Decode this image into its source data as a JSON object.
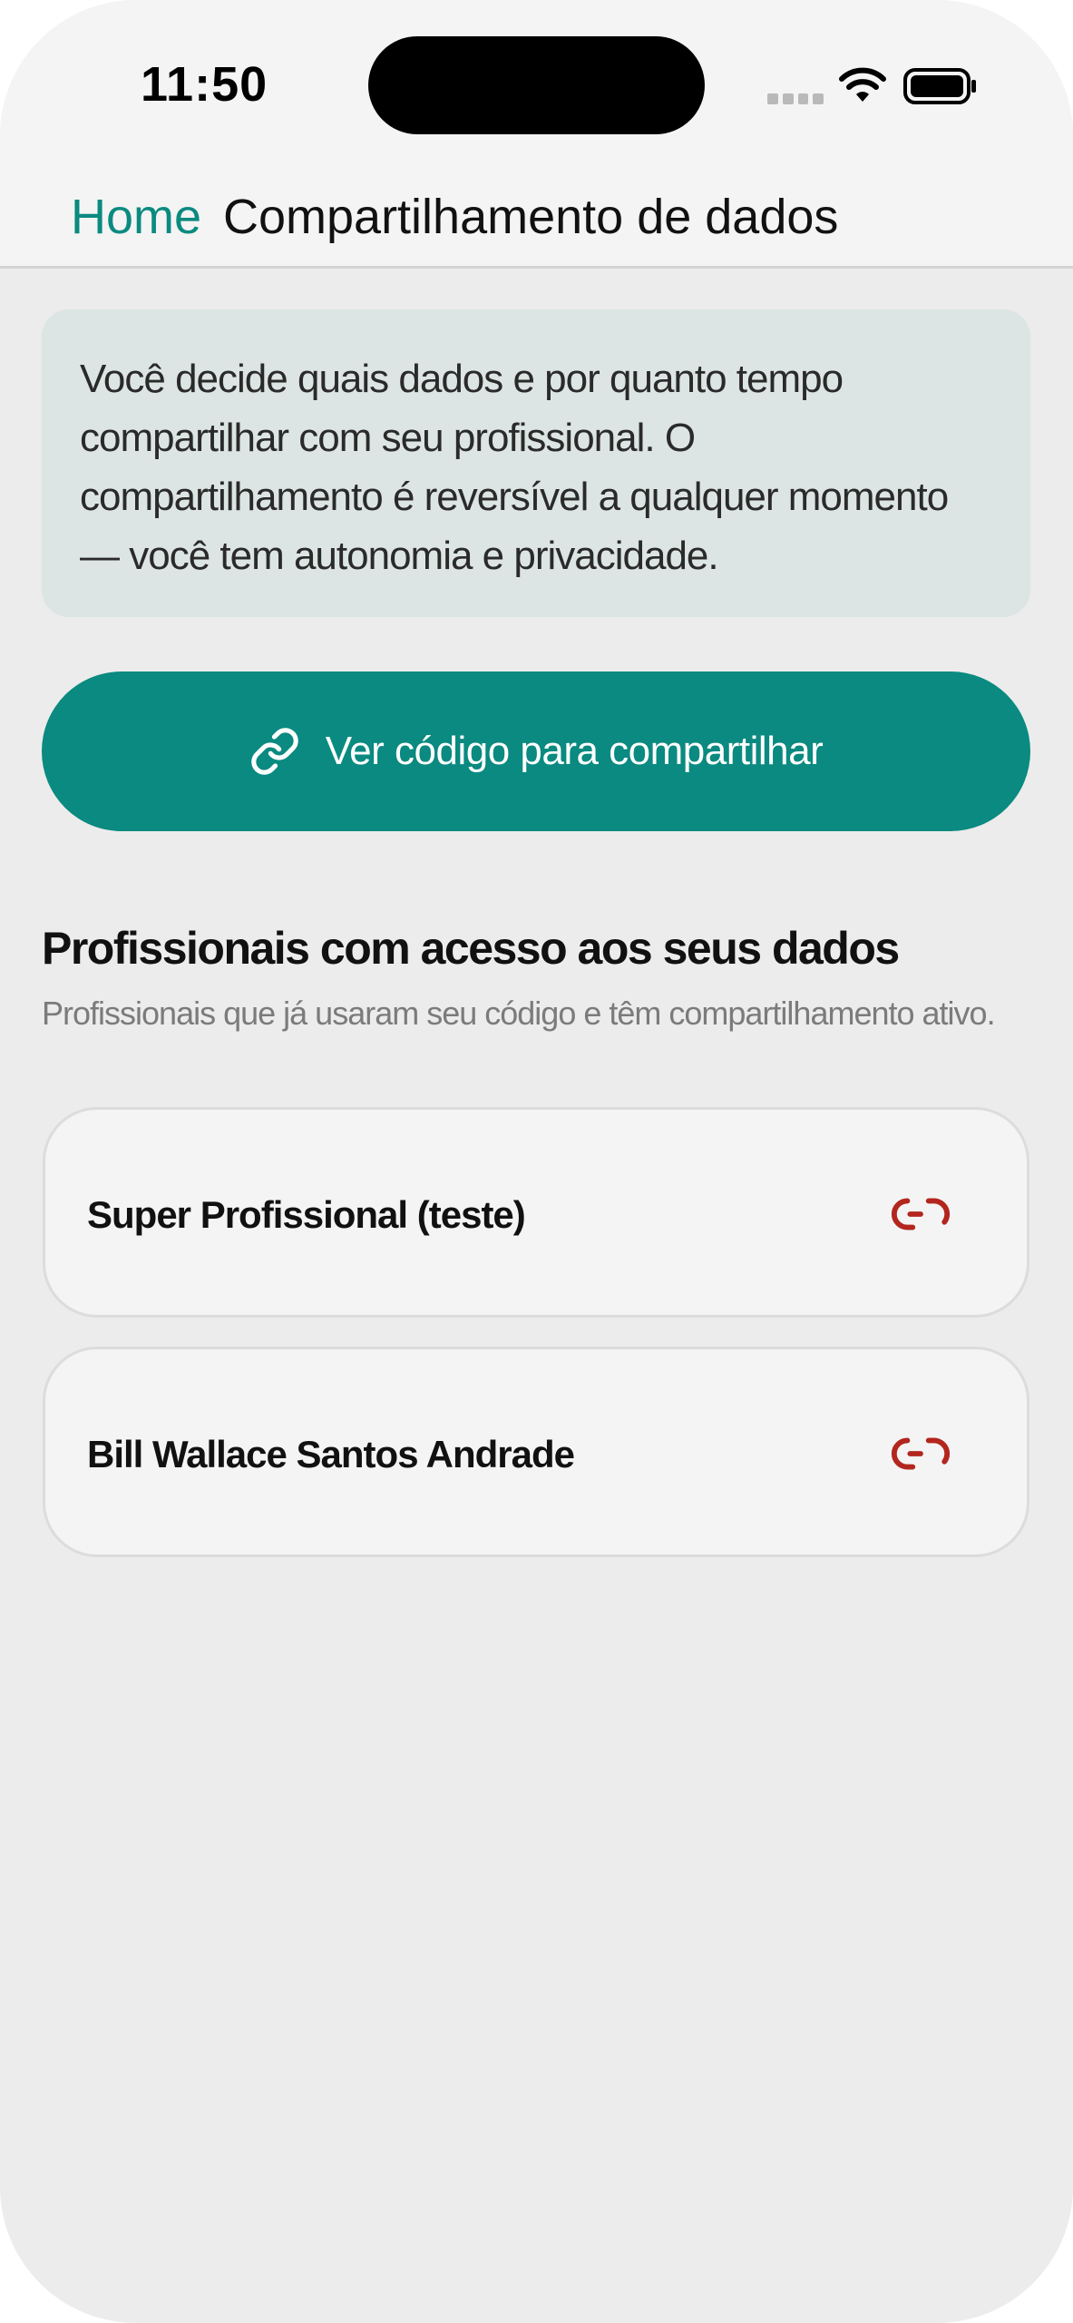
{
  "status_bar": {
    "time": "11:50"
  },
  "nav": {
    "back_label": "Home",
    "title": "Compartilhamento de dados"
  },
  "info": {
    "text": "Você decide quais dados e por quanto tempo compartilhar com seu profissional. O compartilhamento é reversível a qualquer momento — você tem autonomia e privacidade."
  },
  "share_button": {
    "label": "Ver código para compartilhar",
    "icon": "link-icon"
  },
  "section": {
    "title": "Profissionais com acesso aos seus dados",
    "subtitle": "Profissionais que já usaram seu código e têm compartilhamento ativo."
  },
  "professionals": [
    {
      "name": "Super Profissional (teste)",
      "action_icon": "unlink-icon"
    },
    {
      "name": "Bill Wallace Santos Andrade",
      "action_icon": "unlink-icon"
    }
  ],
  "colors": {
    "accent": "#0a8a80",
    "danger": "#b3261e",
    "info_bg": "#dce5e3",
    "background": "#ececec"
  }
}
